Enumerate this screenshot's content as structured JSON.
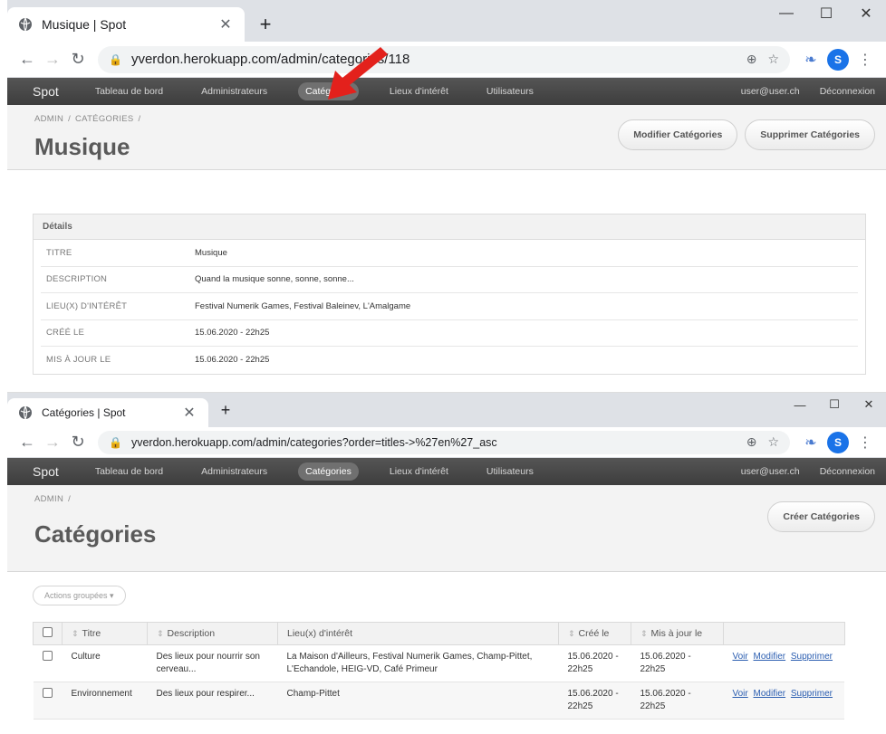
{
  "screens": [
    {
      "tab_title": "Musique | Spot",
      "url": "yverdon.herokuapp.com/admin/categories/118",
      "avatar_letter": "S",
      "nav": {
        "brand": "Spot",
        "items": [
          "Tableau de bord",
          "Administrateurs",
          "Catégories",
          "Lieux d'intérêt",
          "Utilisateurs"
        ],
        "user": "user@user.ch",
        "logout": "Déconnexion"
      },
      "breadcrumb": [
        "ADMIN",
        "/",
        "CATÉGORIES",
        "/"
      ],
      "title": "Musique",
      "buttons": [
        "Modifier Catégories",
        "Supprimer Catégories"
      ],
      "panel_title": "Détails",
      "details": [
        {
          "label": "TITRE",
          "value": "Musique"
        },
        {
          "label": "DESCRIPTION",
          "value": "Quand la musique sonne, sonne, sonne..."
        },
        {
          "label": "LIEU(X) D'INTÉRÊT",
          "value": "Festival Numerik Games, Festival Baleinev, L'Amalgame"
        },
        {
          "label": "CRÉÉ LE",
          "value": "15.06.2020 - 22h25"
        },
        {
          "label": "MIS À JOUR LE",
          "value": "15.06.2020 - 22h25"
        }
      ]
    },
    {
      "tab_title": "Catégories | Spot",
      "url": "yverdon.herokuapp.com/admin/categories?order=titles->%27en%27_asc",
      "avatar_letter": "S",
      "nav": {
        "brand": "Spot",
        "items": [
          "Tableau de bord",
          "Administrateurs",
          "Catégories",
          "Lieux d'intérêt",
          "Utilisateurs"
        ],
        "user": "user@user.ch",
        "logout": "Déconnexion"
      },
      "breadcrumb": [
        "ADMIN",
        "/"
      ],
      "title": "Catégories",
      "buttons": [
        "Créer Catégories"
      ],
      "bulk_actions": "Actions groupées ▾",
      "columns": [
        "Titre",
        "Description",
        "Lieu(x) d'intérêt",
        "Créé le",
        "Mis à jour le"
      ],
      "rows": [
        {
          "title": "Culture",
          "description": "Des lieux pour nourrir son cerveau...",
          "places": "La Maison d'Ailleurs, Festival Numerik Games, Champ-Pittet, L'Echandole, HEIG-VD, Café Primeur",
          "created": "15.06.2020 - 22h25",
          "updated": "15.06.2020 - 22h25"
        },
        {
          "title": "Environnement",
          "description": "Des lieux pour respirer...",
          "places": "Champ-Pittet",
          "created": "15.06.2020 - 22h25",
          "updated": "15.06.2020 - 22h25"
        }
      ],
      "row_actions": [
        "Voir",
        "Modifier",
        "Supprimer"
      ]
    }
  ],
  "colors": {
    "navbar": "#4b4b4b",
    "active_pill": "#707070",
    "link": "#2a5db0",
    "arrow": "#e3211c",
    "avatar": "#1a73e8"
  }
}
